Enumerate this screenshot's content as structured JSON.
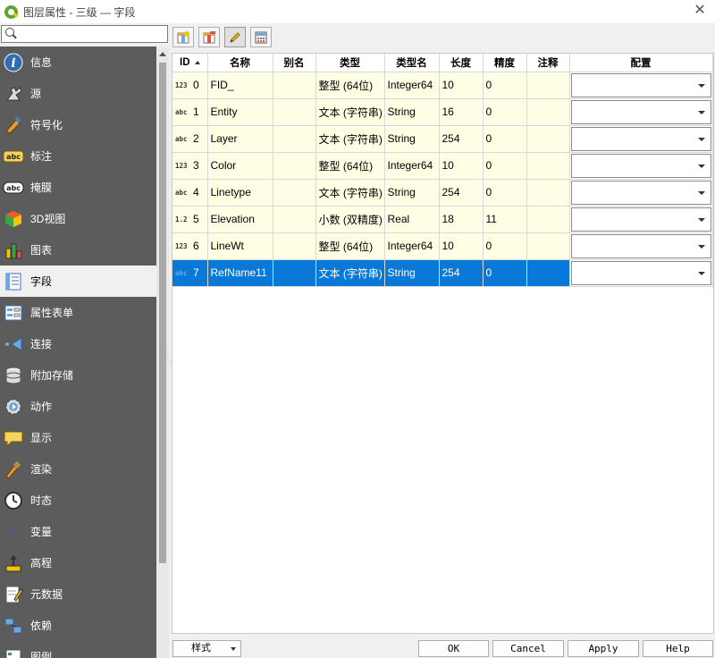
{
  "window": {
    "title": "图层属性 - 三级 — 字段"
  },
  "search": {
    "placeholder": ""
  },
  "sidebar": {
    "items": [
      {
        "label": "信息",
        "icon": "info-icon"
      },
      {
        "label": "源",
        "icon": "source-icon"
      },
      {
        "label": "符号化",
        "icon": "symbology-icon"
      },
      {
        "label": "标注",
        "icon": "labels-icon"
      },
      {
        "label": "掩膜",
        "icon": "mask-icon"
      },
      {
        "label": "3D视图",
        "icon": "3d-view-icon"
      },
      {
        "label": "图表",
        "icon": "diagrams-icon"
      },
      {
        "label": "字段",
        "icon": "fields-icon",
        "selected": true
      },
      {
        "label": "属性表单",
        "icon": "attributes-form-icon"
      },
      {
        "label": "连接",
        "icon": "joins-icon"
      },
      {
        "label": "附加存储",
        "icon": "auxiliary-storage-icon"
      },
      {
        "label": "动作",
        "icon": "actions-icon"
      },
      {
        "label": "显示",
        "icon": "display-icon"
      },
      {
        "label": "渲染",
        "icon": "rendering-icon"
      },
      {
        "label": "时态",
        "icon": "temporal-icon"
      },
      {
        "label": "变量",
        "icon": "variables-icon"
      },
      {
        "label": "高程",
        "icon": "elevation-icon"
      },
      {
        "label": "元数据",
        "icon": "metadata-icon"
      },
      {
        "label": "依赖",
        "icon": "dependencies-icon"
      },
      {
        "label": "图例",
        "icon": "legend-icon"
      }
    ]
  },
  "toolbar": {
    "buttons": [
      "new-field-icon",
      "delete-field-icon",
      "toggle-editing-icon",
      "field-calculator-icon"
    ]
  },
  "table": {
    "columns": [
      "ID",
      "名称",
      "别名",
      "类型",
      "类型名",
      "长度",
      "精度",
      "注释",
      "配置"
    ],
    "rows": [
      {
        "type_badge": "123",
        "id": "0",
        "name": "FID_",
        "alias": "",
        "type": "整型 (64位)",
        "type_name": "Integer64",
        "length": "10",
        "precision": "0",
        "comment": "",
        "config": ""
      },
      {
        "type_badge": "abc",
        "id": "1",
        "name": "Entity",
        "alias": "",
        "type": "文本 (字符串)",
        "type_name": "String",
        "length": "16",
        "precision": "0",
        "comment": "",
        "config": ""
      },
      {
        "type_badge": "abc",
        "id": "2",
        "name": "Layer",
        "alias": "",
        "type": "文本 (字符串)",
        "type_name": "String",
        "length": "254",
        "precision": "0",
        "comment": "",
        "config": ""
      },
      {
        "type_badge": "123",
        "id": "3",
        "name": "Color",
        "alias": "",
        "type": "整型 (64位)",
        "type_name": "Integer64",
        "length": "10",
        "precision": "0",
        "comment": "",
        "config": ""
      },
      {
        "type_badge": "abc",
        "id": "4",
        "name": "Linetype",
        "alias": "",
        "type": "文本 (字符串)",
        "type_name": "String",
        "length": "254",
        "precision": "0",
        "comment": "",
        "config": ""
      },
      {
        "type_badge": "1.2",
        "id": "5",
        "name": "Elevation",
        "alias": "",
        "type": "小数 (双精度)",
        "type_name": "Real",
        "length": "18",
        "precision": "11",
        "comment": "",
        "config": ""
      },
      {
        "type_badge": "123",
        "id": "6",
        "name": "LineWt",
        "alias": "",
        "type": "整型 (64位)",
        "type_name": "Integer64",
        "length": "10",
        "precision": "0",
        "comment": "",
        "config": ""
      },
      {
        "type_badge": "abc",
        "id": "7",
        "name": "RefName11",
        "alias": "",
        "type": "文本 (字符串)",
        "type_name": "String",
        "length": "254",
        "precision": "0",
        "comment": "",
        "config": "",
        "selected": true
      }
    ]
  },
  "footer": {
    "style_label": "样式",
    "ok_label": "OK",
    "cancel_label": "Cancel",
    "apply_label": "Apply",
    "help_label": "Help"
  },
  "colors": {
    "sidebar_bg": "#5c5c5c",
    "row_bg": "#fefee4",
    "selection": "#0a78d7",
    "qgis_green": "#5ba531"
  }
}
